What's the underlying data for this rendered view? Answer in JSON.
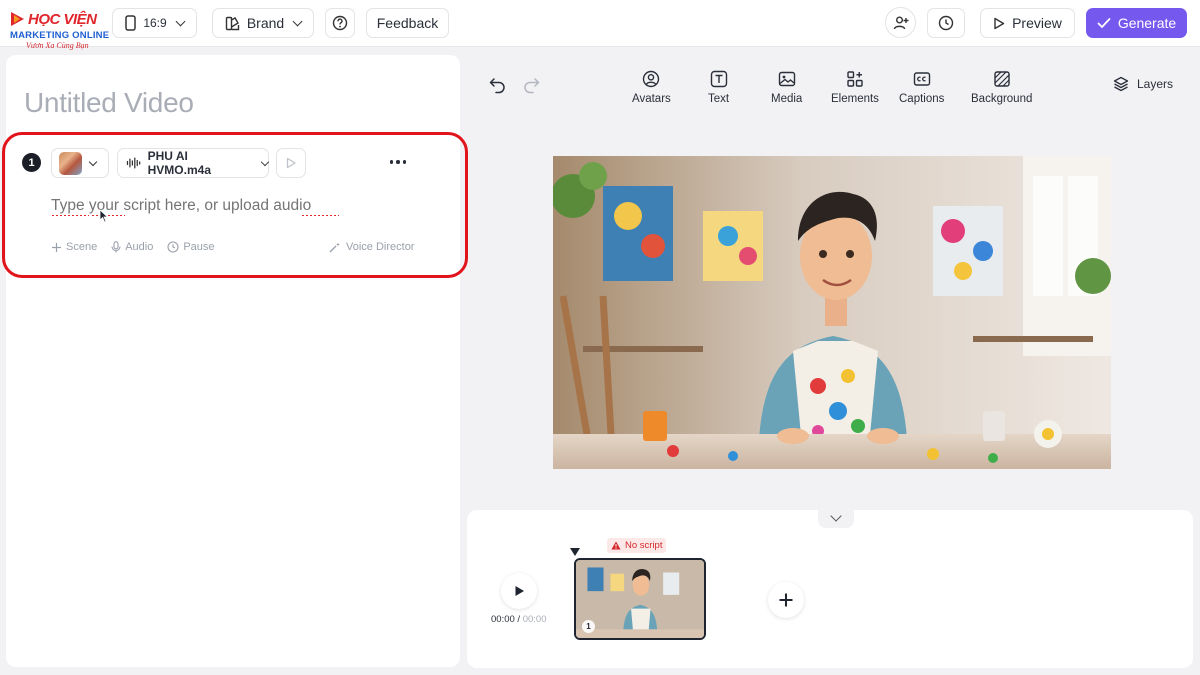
{
  "header": {
    "logo": {
      "brand": "HỌC VIỆN",
      "sub": "MARKETING ONLINE",
      "tagline": "Vươn Xa Cùng Bạn"
    },
    "aspect_ratio": "16:9",
    "brand_label": "Brand",
    "feedback_label": "Feedback",
    "preview_label": "Preview",
    "generate_label": "Generate"
  },
  "editor": {
    "video_title": "Untitled Video",
    "scene": {
      "number": "1",
      "audio_file": "PHU AI HVMO.m4a",
      "script_placeholder": "Type your script here, or upload audio",
      "actions": {
        "scene": "Scene",
        "audio": "Audio",
        "pause": "Pause"
      },
      "voice_director": "Voice Director"
    }
  },
  "toolbar": {
    "items": [
      {
        "label": "Avatars",
        "icon": "avatar-icon"
      },
      {
        "label": "Text",
        "icon": "text-icon"
      },
      {
        "label": "Media",
        "icon": "media-icon"
      },
      {
        "label": "Elements",
        "icon": "elements-icon"
      },
      {
        "label": "Captions",
        "icon": "captions-icon"
      },
      {
        "label": "Background",
        "icon": "background-icon"
      }
    ],
    "layers_label": "Layers"
  },
  "timeline": {
    "current_time": "00:00",
    "total_time": "00:00",
    "warning": "No script",
    "clip_number": "1"
  },
  "colors": {
    "accent": "#7559ee",
    "highlight_border": "#e2141b",
    "warning": "#d6262b"
  }
}
